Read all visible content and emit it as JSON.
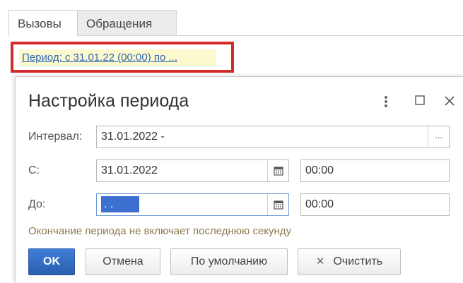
{
  "tabs": [
    {
      "label": "Вызовы",
      "active": true
    },
    {
      "label": "Обращения",
      "active": false
    }
  ],
  "period_link": "Период: с 31.01.22 (00:00)  по ...",
  "dialog": {
    "title": "Настройка периода",
    "icons": {
      "more": "more-vertical-icon",
      "maximize": "maximize-icon",
      "close": "close-icon"
    },
    "interval": {
      "label": "Интервал:",
      "value": "31.01.2022 -",
      "button": "..."
    },
    "from": {
      "label": "С:",
      "date": "31.01.2022",
      "time": "00:00"
    },
    "to": {
      "label": "До:",
      "date": "  .  .",
      "time": "00:00"
    },
    "hint": "Окончание периода не включает последнюю секунду",
    "buttons": {
      "ok": "OK",
      "cancel": "Отмена",
      "default": "По умолчанию",
      "clear": "Очистить"
    }
  },
  "colors": {
    "highlight_border": "#d32a2a",
    "link": "#2d66b3",
    "link_background": "#fdf9cf",
    "primary_button": "#2a5fae",
    "selection": "#3d6fd0",
    "hint": "#8a7a4a"
  }
}
